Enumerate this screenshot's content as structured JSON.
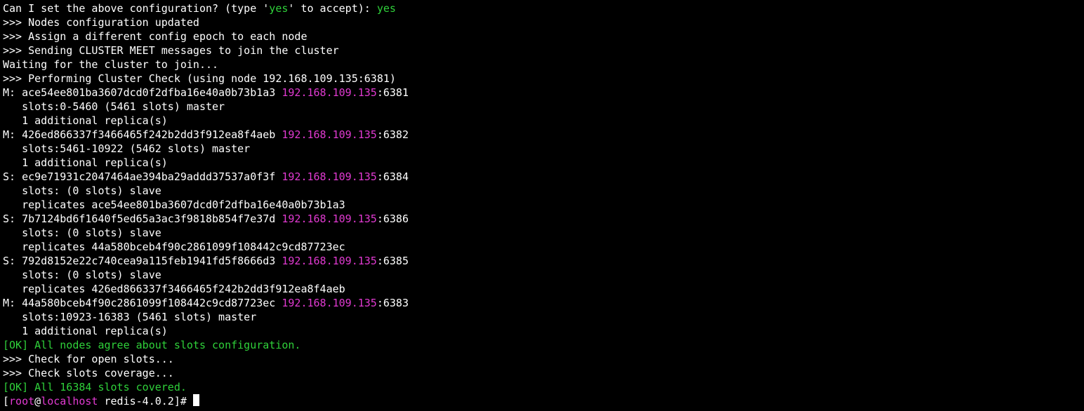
{
  "colors": {
    "green": "#2fd13a",
    "magenta": "#e23ad2",
    "fg": "#ffffff",
    "bg": "#000000"
  },
  "prompt": {
    "question": "Can I set the above configuration? (type '",
    "yes_token": "yes",
    "question_mid": "' to accept): ",
    "answer": "yes"
  },
  "header_lines": [
    ">>> Nodes configuration updated",
    ">>> Assign a different config epoch to each node",
    ">>> Sending CLUSTER MEET messages to join the cluster"
  ],
  "waiting": "Waiting for the cluster to join...",
  "check_header": {
    "prefix": ">>> Performing Cluster Check (using node ",
    "node": "192.168.109.135:6381",
    "suffix": ")"
  },
  "nodes": [
    {
      "role": "M",
      "id": "ace54ee801ba3607dcd0f2dfba16e40a0b73b1a3",
      "ip": "192.168.109.135",
      "port": "6381",
      "line2": "   slots:0-5460 (5461 slots) master",
      "line3": "   1 additional replica(s)"
    },
    {
      "role": "M",
      "id": "426ed866337f3466465f242b2dd3f912ea8f4aeb",
      "ip": "192.168.109.135",
      "port": "6382",
      "line2": "   slots:5461-10922 (5462 slots) master",
      "line3": "   1 additional replica(s)"
    },
    {
      "role": "S",
      "id": "ec9e71931c2047464ae394ba29addd37537a0f3f",
      "ip": "192.168.109.135",
      "port": "6384",
      "line2": "   slots: (0 slots) slave",
      "line3": "   replicates ace54ee801ba3607dcd0f2dfba16e40a0b73b1a3"
    },
    {
      "role": "S",
      "id": "7b7124bd6f1640f5ed65a3ac3f9818b854f7e37d",
      "ip": "192.168.109.135",
      "port": "6386",
      "line2": "   slots: (0 slots) slave",
      "line3": "   replicates 44a580bceb4f90c2861099f108442c9cd87723ec"
    },
    {
      "role": "S",
      "id": "792d8152e22c740cea9a115feb1941fd5f8666d3",
      "ip": "192.168.109.135",
      "port": "6385",
      "line2": "   slots: (0 slots) slave",
      "line3": "   replicates 426ed866337f3466465f242b2dd3f912ea8f4aeb"
    },
    {
      "role": "M",
      "id": "44a580bceb4f90c2861099f108442c9cd87723ec",
      "ip": "192.168.109.135",
      "port": "6383",
      "line2": "   slots:10923-16383 (5461 slots) master",
      "line3": "   1 additional replica(s)"
    }
  ],
  "ok1": "[OK] All nodes agree about slots configuration.",
  "check_open": ">>> Check for open slots...",
  "check_cov": ">>> Check slots coverage...",
  "ok2": "[OK] All 16384 slots covered.",
  "shell": {
    "lb": "[",
    "user": "root",
    "at": "@",
    "host": "localhost",
    "dir": " redis-4.0.2",
    "rb": "]# "
  }
}
